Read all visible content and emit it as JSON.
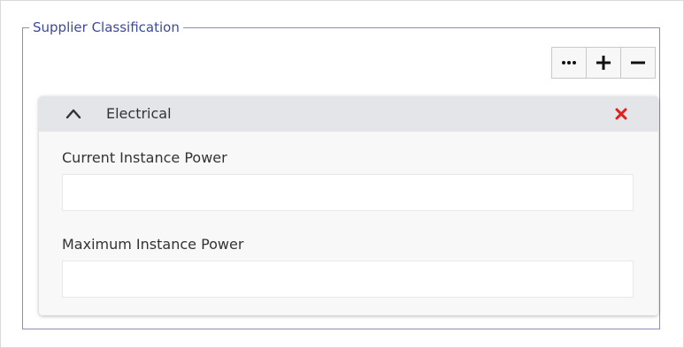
{
  "section": {
    "legend": "Supplier Classification"
  },
  "toolbar": {
    "buttons": [
      {
        "icon": "ellipsis-icon"
      },
      {
        "icon": "plus-icon"
      },
      {
        "icon": "minus-icon"
      }
    ]
  },
  "card": {
    "title": "Electrical",
    "collapse_icon": "chevron-up-icon",
    "remove_icon": "close-icon",
    "remove_color": "#e0201c",
    "fields": [
      {
        "label": "Current Instance Power",
        "value": ""
      },
      {
        "label": "Maximum Instance Power",
        "value": ""
      }
    ]
  },
  "colors": {
    "legend": "#3c4a9a",
    "fieldset_border": "#8a8fc0",
    "header_bg": "#e3e5e8"
  }
}
